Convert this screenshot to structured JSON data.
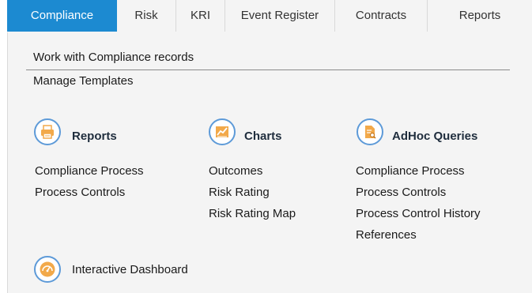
{
  "tabs": [
    {
      "label": "Compliance",
      "active": true
    },
    {
      "label": "Risk",
      "active": false
    },
    {
      "label": "KRI",
      "active": false
    },
    {
      "label": "Event Register",
      "active": false
    },
    {
      "label": "Contracts",
      "active": false
    },
    {
      "label": "Reports",
      "active": false
    }
  ],
  "menu": {
    "work_with": "Work with Compliance records",
    "manage_templates": "Manage Templates"
  },
  "sections": {
    "reports": {
      "heading": "Reports",
      "icon": "printer-icon",
      "items": [
        "Compliance Process",
        "Process Controls"
      ]
    },
    "charts": {
      "heading": "Charts",
      "icon": "line-chart-icon",
      "items": [
        "Outcomes",
        "Risk Rating",
        "Risk Rating Map"
      ]
    },
    "adhoc": {
      "heading": "AdHoc Queries",
      "icon": "document-search-icon",
      "items": [
        "Compliance Process",
        "Process Controls",
        "Process Control History",
        "References"
      ]
    },
    "dashboard": {
      "heading": "Interactive Dashboard",
      "icon": "gauge-icon"
    }
  },
  "colors": {
    "accent": "#1c8ad1",
    "icon_orange": "#f2a94a",
    "icon_ring": "#5d9ad8"
  }
}
